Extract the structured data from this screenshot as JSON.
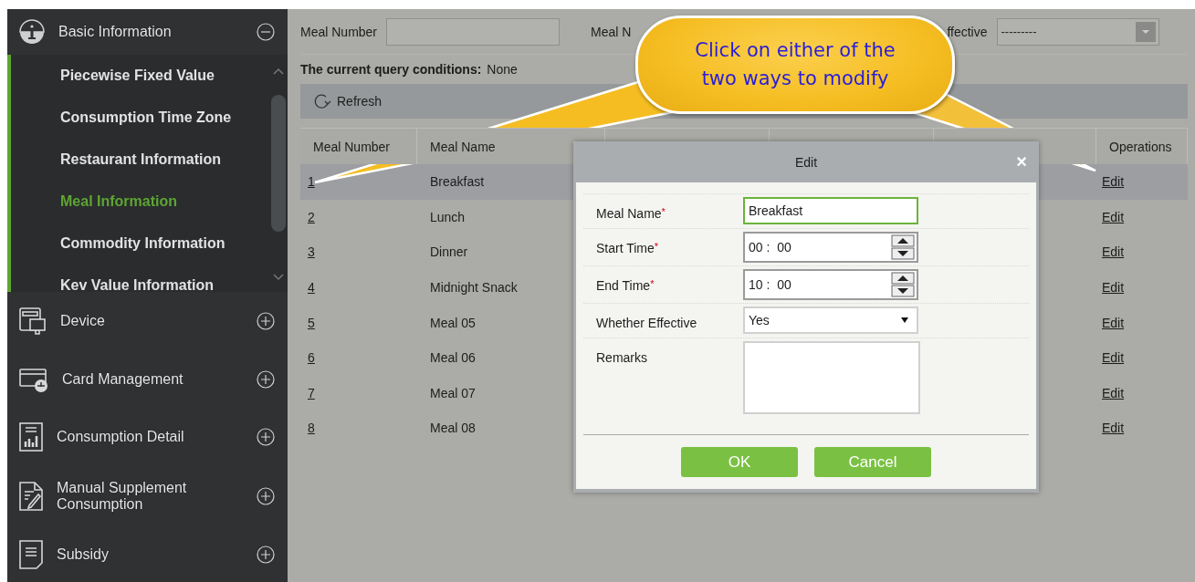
{
  "sidebar": {
    "sections": [
      {
        "label": "Basic Information",
        "kind": "info",
        "expanded": true,
        "children": [
          {
            "label": "Piecewise Fixed Value",
            "selected": false
          },
          {
            "label": "Consumption Time Zone",
            "selected": false
          },
          {
            "label": "Restaurant Information",
            "selected": false
          },
          {
            "label": "Meal Information",
            "selected": true
          },
          {
            "label": "Commodity Information",
            "selected": false
          },
          {
            "label": "Kev Value Information",
            "selected": false
          }
        ]
      },
      {
        "label": "Device",
        "kind": "device",
        "expanded": false
      },
      {
        "label": "Card Management",
        "kind": "card",
        "expanded": false
      },
      {
        "label": "Consumption Detail",
        "kind": "report",
        "expanded": false
      },
      {
        "label": "Manual Supplement Consumption",
        "kind": "document",
        "expanded": false
      },
      {
        "label": "Subsidy",
        "kind": "list",
        "expanded": false
      }
    ]
  },
  "filter": {
    "fields": [
      {
        "label": "Meal Number",
        "kind": "text"
      },
      {
        "label": "Meal N",
        "kind": "hidden"
      },
      {
        "label": "ffective",
        "kind": "select",
        "value": "---------"
      }
    ]
  },
  "query": {
    "label": "The current query conditions:",
    "value": "None"
  },
  "toolbar": {
    "refresh": "Refresh"
  },
  "table": {
    "columns": [
      "Meal Number",
      "Meal Name",
      "",
      "",
      "",
      "Operations"
    ],
    "rows": [
      {
        "number": "1",
        "name": "Breakfast",
        "action": "Edit",
        "selected": true
      },
      {
        "number": "2",
        "name": "Lunch",
        "action": "Edit",
        "selected": false
      },
      {
        "number": "3",
        "name": "Dinner",
        "action": "Edit",
        "selected": false
      },
      {
        "number": "4",
        "name": "Midnight Snack",
        "action": "Edit",
        "selected": false
      },
      {
        "number": "5",
        "name": "Meal 05",
        "action": "Edit",
        "selected": false
      },
      {
        "number": "6",
        "name": "Meal 06",
        "action": "Edit",
        "selected": false
      },
      {
        "number": "7",
        "name": "Meal 07",
        "action": "Edit",
        "selected": false
      },
      {
        "number": "8",
        "name": "Meal 08",
        "action": "Edit",
        "selected": false
      }
    ]
  },
  "dialog": {
    "title": "Edit",
    "close": "×",
    "fields": [
      {
        "label": "Meal Name",
        "required_mark": "*",
        "kind": "text",
        "value": "Breakfast",
        "focused": true
      },
      {
        "label": "Start Time",
        "required_mark": "*",
        "kind": "time",
        "value": "00 :  00",
        "focused": false
      },
      {
        "label": "End Time",
        "required_mark": "*",
        "kind": "time",
        "value": "10 :  00",
        "focused": false
      },
      {
        "label": "Whether Effective",
        "kind": "select",
        "value": "Yes",
        "focused": false
      },
      {
        "label": "Remarks",
        "kind": "textarea",
        "focused": false
      }
    ],
    "buttons": [
      "OK",
      "Cancel"
    ]
  },
  "callout": {
    "lines": [
      "Click on either of the",
      "two ways to modify"
    ]
  }
}
